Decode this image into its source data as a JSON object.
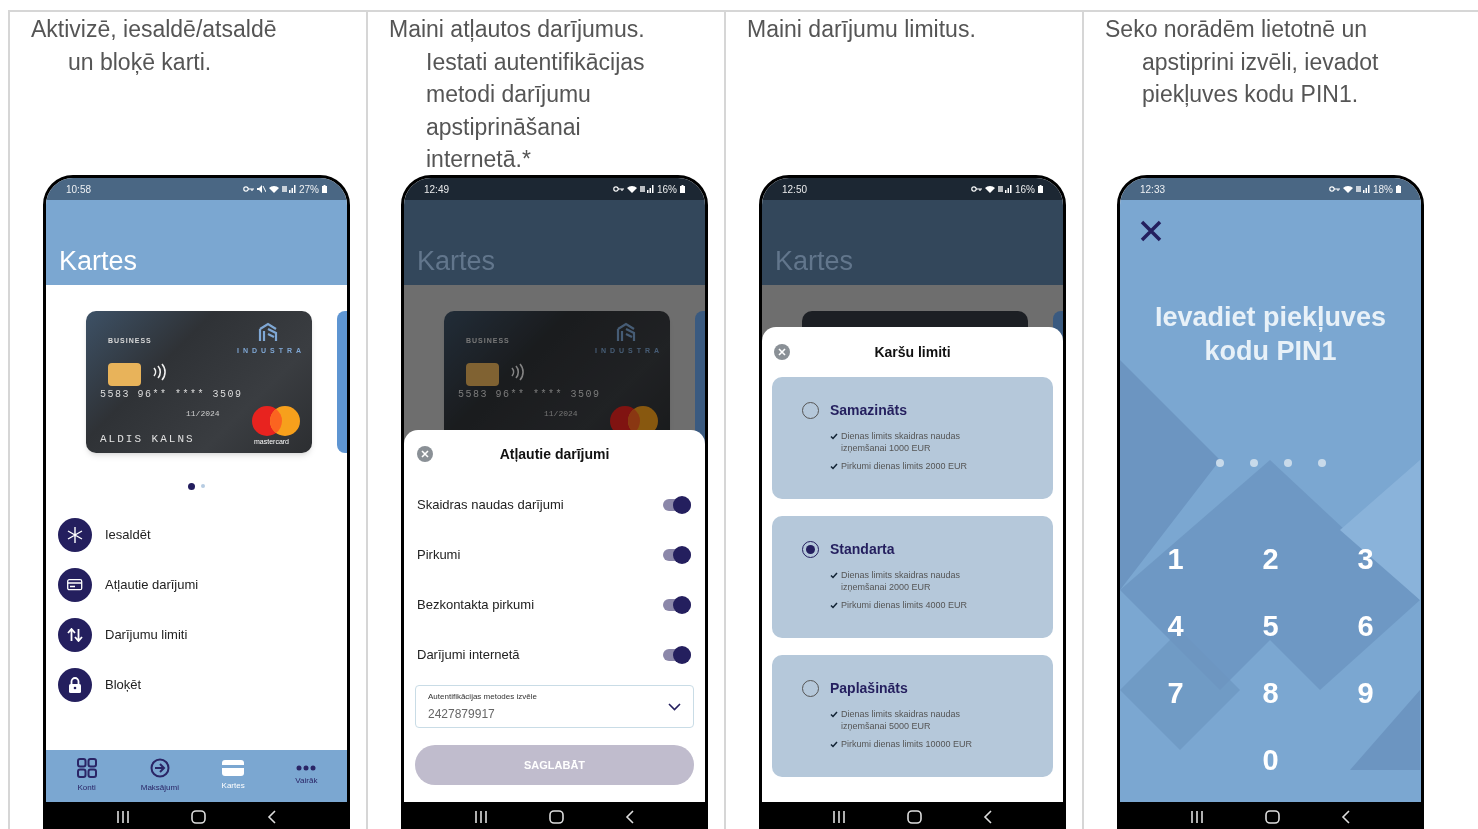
{
  "columns": [
    {
      "caption": "Aktivizē, iesaldē/atsaldē un bloķē karti.",
      "phone": {
        "kind": "cards",
        "time": "10:58",
        "battery": "27%",
        "muted": true,
        "dimmed": false,
        "title": "Kartes",
        "card": {
          "tier": "BUSINESS",
          "brand": "INDUSTRA",
          "number": "5583 96** **** 3509",
          "valid": "11/2024",
          "holder": "ALDIS KALNS",
          "network": "mastercard"
        },
        "pager": [
          {
            "selected": true
          },
          {
            "selected": false
          }
        ],
        "actions": [
          {
            "kind": "freeze",
            "label": "Iesaldēt"
          },
          {
            "kind": "permissions",
            "label": "Atļautie darījumi"
          },
          {
            "kind": "limits",
            "label": "Darījumu limiti"
          },
          {
            "kind": "block",
            "label": "Bloķēt"
          }
        ],
        "nav": [
          {
            "kind": "accounts",
            "label": "Konti",
            "selected": false
          },
          {
            "kind": "payments",
            "label": "Maksājumi",
            "selected": false
          },
          {
            "kind": "cards",
            "label": "Kartes",
            "selected": true
          },
          {
            "kind": "more",
            "label": "Vairāk",
            "selected": false
          }
        ]
      }
    },
    {
      "caption": "Maini atļautos darījumus. Iestati autentifikācijas metodi darījumu apstiprināšanai internetā.*",
      "phone": {
        "kind": "allowed",
        "time": "12:49",
        "battery": "16%",
        "dimmed": true,
        "title": "Kartes",
        "card": {
          "tier": "BUSINESS",
          "brand": "INDUSTRA",
          "number": "5583 96** **** 3509",
          "valid": "11/2024"
        },
        "sheet": {
          "title": "Atļautie darījumi",
          "toggles": [
            {
              "label": "Skaidras naudas darījumi",
              "on": true
            },
            {
              "label": "Pirkumi",
              "on": true
            },
            {
              "label": "Bezkontakta pirkumi",
              "on": true
            },
            {
              "label": "Darījumi internetā",
              "on": true
            }
          ],
          "select": {
            "label": "Autentifikācijas metodes izvēle",
            "value": "2427879917"
          },
          "button": {
            "label": "SAGLABĀT",
            "disabled": true
          }
        }
      }
    },
    {
      "caption": "Maini darījumu limitus.",
      "phone": {
        "kind": "limits",
        "time": "12:50",
        "battery": "16%",
        "dimmed": true,
        "title": "Kartes",
        "sheet": {
          "title": "Karšu limiti",
          "options": [
            {
              "name": "Samazināts",
              "selected": false,
              "lines": [
                "Dienas limits skaidras naudas izņemšanai 1000 EUR",
                "Pirkumi dienas limits 2000 EUR"
              ]
            },
            {
              "name": "Standarta",
              "selected": true,
              "lines": [
                "Dienas limits skaidras naudas izņemšanai 2000 EUR",
                "Pirkumi dienas limits 4000 EUR"
              ]
            },
            {
              "name": "Paplašināts",
              "selected": false,
              "lines": [
                "Dienas limits skaidras naudas izņemšanai 5000 EUR",
                "Pirkumi dienas limits 10000 EUR"
              ]
            }
          ]
        }
      }
    },
    {
      "caption": "Seko norādēm lietotnē un apstiprini izvēli, ievadot piekļuves kodu PIN1.",
      "phone": {
        "kind": "pin",
        "time": "12:33",
        "battery": "18%",
        "title": "Ievadiet piekļuves kodu PIN1",
        "dots": [
          {
            "filled": false
          },
          {
            "filled": false
          },
          {
            "filled": false
          },
          {
            "filled": false
          }
        ],
        "keys": [
          "1",
          "2",
          "3",
          "4",
          "5",
          "6",
          "7",
          "8",
          "9",
          "0"
        ]
      }
    }
  ]
}
